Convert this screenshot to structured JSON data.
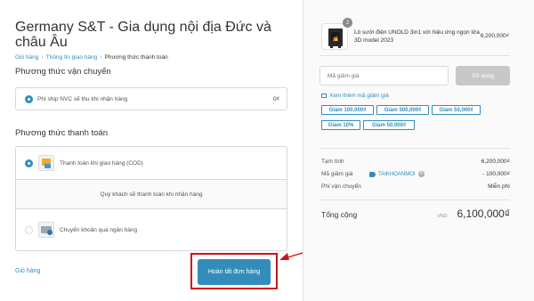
{
  "store": {
    "title": "Germany S&T - Gia dụng nội địa Đức và châu Âu"
  },
  "breadcrumb": {
    "items": [
      "Giỏ hàng",
      "Thông tin giao hàng",
      "Phương thức thanh toán"
    ]
  },
  "shipping": {
    "title": "Phương thức vận chuyển",
    "option_label": "Phí ship NVC sẽ thu khi nhận hàng",
    "option_price": "0₫"
  },
  "payment": {
    "title": "Phương thức thanh toán",
    "cod_label": "Thanh toán khi giao hàng (COD)",
    "cod_note": "Quý khách sẽ thanh toán khi nhận hàng",
    "bank_label": "Chuyển khoản qua ngân hàng"
  },
  "footer": {
    "back_label": "Giỏ hàng",
    "complete_label": "Hoàn tất đơn hàng"
  },
  "cart": {
    "quantity": "2",
    "product_name": "Lò sưởi điện UNOLD 3in1 với hiệu ứng ngọn lửa 3D model 2023",
    "product_price": "6,200,000₫"
  },
  "coupon": {
    "placeholder": "Mã giảm giá",
    "apply_label": "Sử dụng",
    "more_label": "Xem thêm mã giảm giá",
    "chips": [
      "Giảm 100,000₫",
      "Giảm 500,000₫",
      "Giảm 50,000₫",
      "Giảm 10%",
      "Giảm 50,000₫"
    ]
  },
  "summary": {
    "subtotal_label": "Tạm tính",
    "subtotal_value": "6,200,000₫",
    "discount_label": "Mã giảm giá",
    "discount_code": "TAIKHOANMOI",
    "discount_value": "- 100,000₫",
    "shipping_label": "Phí vận chuyển",
    "shipping_value": "Miễn phí",
    "total_label": "Tổng cộng",
    "currency": "VND",
    "total_value": "6,100,000₫"
  },
  "colors": {
    "accent": "#338dbc",
    "highlight": "#d0121b",
    "disabled": "#c8c8c8"
  }
}
